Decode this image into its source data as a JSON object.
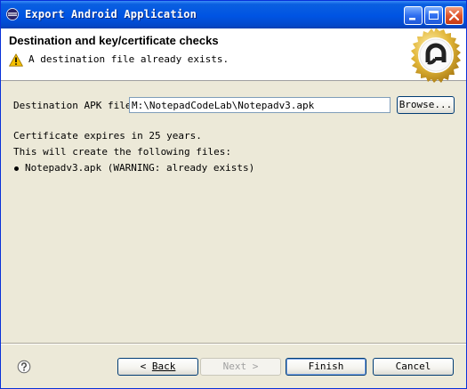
{
  "window": {
    "title": "Export Android Application"
  },
  "header": {
    "title": "Destination and key/certificate checks",
    "message": "A destination file already exists."
  },
  "form": {
    "apk_label": "Destination APK file:",
    "apk_value": "M:\\NotepadCodeLab\\Notepadv3.apk",
    "browse_label": "Browse..."
  },
  "info": {
    "cert_expiry": "Certificate expires in 25 years.",
    "will_create": "This will create the following files:",
    "files": [
      "Notepadv3.apk (WARNING: already exists)"
    ]
  },
  "footer": {
    "back_label": "Back",
    "next_label": "Next",
    "finish_label": "Finish",
    "cancel_label": "Cancel"
  },
  "colors": {
    "titlebar": "#0054e3",
    "warning": "#f5c000",
    "logo_gold": "#d4a829"
  }
}
